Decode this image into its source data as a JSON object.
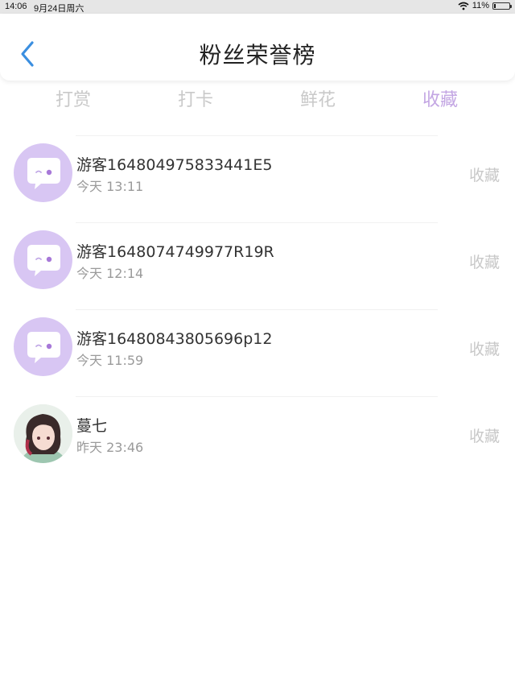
{
  "status_bar": {
    "time": "14:06",
    "date": "9月24日周六",
    "battery": "11%",
    "battery_level": 0.11
  },
  "header": {
    "title": "粉丝荣誉榜",
    "back_icon": "chevron-left-icon"
  },
  "tabs": [
    {
      "label": "打赏",
      "active": false
    },
    {
      "label": "打卡",
      "active": false
    },
    {
      "label": "鲜花",
      "active": false
    },
    {
      "label": "收藏",
      "active": true
    }
  ],
  "list": [
    {
      "name": "游客164804975833441E5",
      "time": "今天 13:11",
      "action": "收藏",
      "avatar": "chat-bubble-avatar"
    },
    {
      "name": "游客1648074749977R19R",
      "time": "今天 12:14",
      "action": "收藏",
      "avatar": "chat-bubble-avatar"
    },
    {
      "name": "游客16480843805696p12",
      "time": "今天 11:59",
      "action": "收藏",
      "avatar": "chat-bubble-avatar"
    },
    {
      "name": "蔓七",
      "time": "昨天 23:46",
      "action": "收藏",
      "avatar": "user-photo-avatar"
    }
  ],
  "colors": {
    "accent": "#c3a6e3",
    "avatar_bg": "#d8c6f3",
    "back_icon": "#3b8fe0",
    "inactive_tab": "#c9c9c9"
  }
}
